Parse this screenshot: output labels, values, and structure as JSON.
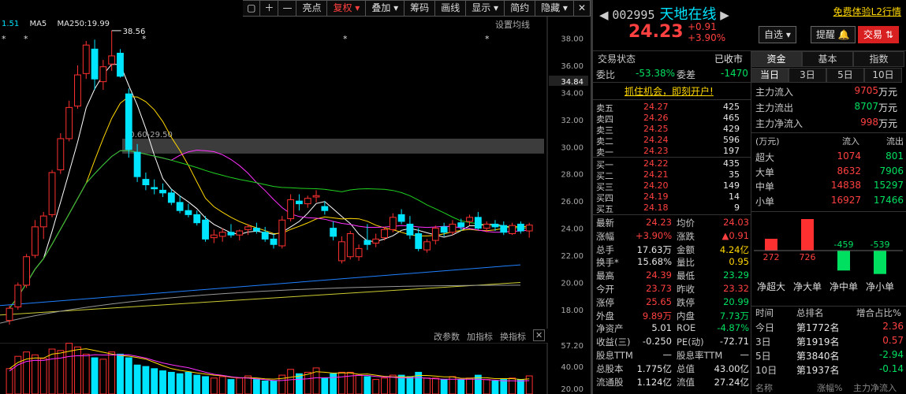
{
  "toolbar": {
    "buttons": [
      "亮点",
      "复权",
      "叠加",
      "筹码",
      "画线",
      "显示",
      "简约",
      "隐藏"
    ],
    "icons": [
      "window-icon",
      "plus-icon",
      "minus-icon"
    ]
  },
  "chart_top": {
    "ma_labels": [
      "1.51",
      "MA5",
      "MA250:19.99"
    ],
    "settings": "设置均线",
    "peak": "38.56",
    "band_label": "30.60-29.50",
    "markers": [
      "*",
      "*",
      "*",
      "*",
      "*",
      "*",
      "*"
    ]
  },
  "y_axis": {
    "ticks": [
      "38.00",
      "36.00",
      "34.00",
      "32.00",
      "30.00",
      "28.00",
      "26.00",
      "24.00",
      "22.00",
      "20.00",
      "18.00"
    ],
    "current": "34.84"
  },
  "indicator": {
    "buttons": [
      "改参数",
      "加指标",
      "换指标"
    ],
    "ticks": [
      "57.20",
      "40.00",
      "20.00"
    ]
  },
  "chart_data": {
    "type": "candlestick",
    "ylim": [
      16.6,
      39.6
    ],
    "candles": [
      {
        "o": 17.2,
        "h": 18.3,
        "l": 16.9,
        "c": 18.1
      },
      {
        "o": 18.2,
        "h": 20.0,
        "l": 18.0,
        "c": 19.8
      },
      {
        "o": 19.8,
        "h": 22.1,
        "l": 19.6,
        "c": 21.9
      },
      {
        "o": 22.0,
        "h": 24.6,
        "l": 21.8,
        "c": 24.1
      },
      {
        "o": 24.1,
        "h": 25.2,
        "l": 23.2,
        "c": 24.9
      },
      {
        "o": 25.0,
        "h": 28.3,
        "l": 24.8,
        "c": 28.1
      },
      {
        "o": 28.3,
        "h": 31.0,
        "l": 28.0,
        "c": 30.6
      },
      {
        "o": 30.6,
        "h": 33.4,
        "l": 30.4,
        "c": 32.9
      },
      {
        "o": 33.0,
        "h": 36.0,
        "l": 32.8,
        "c": 35.3
      },
      {
        "o": 35.4,
        "h": 37.8,
        "l": 35.0,
        "c": 37.5
      },
      {
        "o": 37.2,
        "h": 37.9,
        "l": 34.2,
        "c": 35.0
      },
      {
        "o": 34.8,
        "h": 36.4,
        "l": 34.2,
        "c": 35.9
      },
      {
        "o": 36.1,
        "h": 38.56,
        "l": 35.6,
        "c": 36.7
      },
      {
        "o": 36.9,
        "h": 37.2,
        "l": 35.1,
        "c": 35.2
      },
      {
        "o": 33.9,
        "h": 34.3,
        "l": 29.2,
        "c": 29.8
      },
      {
        "o": 29.6,
        "h": 30.2,
        "l": 27.4,
        "c": 27.8
      },
      {
        "o": 27.6,
        "h": 28.1,
        "l": 26.8,
        "c": 27.2
      },
      {
        "o": 27.0,
        "h": 27.6,
        "l": 26.5,
        "c": 26.9
      },
      {
        "o": 26.8,
        "h": 27.3,
        "l": 26.3,
        "c": 26.6
      },
      {
        "o": 26.6,
        "h": 26.9,
        "l": 25.7,
        "c": 25.9
      },
      {
        "o": 25.9,
        "h": 26.4,
        "l": 25.1,
        "c": 25.3
      },
      {
        "o": 25.3,
        "h": 25.8,
        "l": 24.8,
        "c": 25.0
      },
      {
        "o": 25.0,
        "h": 25.3,
        "l": 24.2,
        "c": 24.4
      },
      {
        "o": 24.6,
        "h": 24.9,
        "l": 23.0,
        "c": 23.2
      },
      {
        "o": 23.3,
        "h": 23.9,
        "l": 22.9,
        "c": 23.5
      },
      {
        "o": 23.4,
        "h": 24.0,
        "l": 23.0,
        "c": 23.7
      },
      {
        "o": 23.7,
        "h": 24.3,
        "l": 23.3,
        "c": 23.5
      },
      {
        "o": 23.5,
        "h": 23.9,
        "l": 23.1,
        "c": 23.8
      },
      {
        "o": 23.9,
        "h": 24.3,
        "l": 23.5,
        "c": 24.1
      },
      {
        "o": 24.0,
        "h": 24.4,
        "l": 23.6,
        "c": 23.8
      },
      {
        "o": 23.7,
        "h": 24.1,
        "l": 23.0,
        "c": 23.2
      },
      {
        "o": 23.2,
        "h": 23.6,
        "l": 22.5,
        "c": 22.8
      },
      {
        "o": 22.7,
        "h": 24.9,
        "l": 22.5,
        "c": 24.6
      },
      {
        "o": 24.7,
        "h": 26.5,
        "l": 24.5,
        "c": 26.1
      },
      {
        "o": 26.0,
        "h": 26.5,
        "l": 25.3,
        "c": 25.8
      },
      {
        "o": 25.8,
        "h": 26.4,
        "l": 25.5,
        "c": 26.2
      },
      {
        "o": 26.3,
        "h": 26.8,
        "l": 25.9,
        "c": 26.4
      },
      {
        "o": 25.6,
        "h": 26.0,
        "l": 25.0,
        "c": 25.3
      },
      {
        "o": 24.0,
        "h": 24.5,
        "l": 23.1,
        "c": 23.4
      },
      {
        "o": 21.6,
        "h": 23.4,
        "l": 21.4,
        "c": 23.0
      },
      {
        "o": 21.9,
        "h": 23.8,
        "l": 21.7,
        "c": 23.6
      },
      {
        "o": 21.9,
        "h": 22.8,
        "l": 21.6,
        "c": 22.5
      },
      {
        "o": 23.1,
        "h": 24.3,
        "l": 22.4,
        "c": 22.8
      },
      {
        "o": 22.9,
        "h": 23.6,
        "l": 22.6,
        "c": 23.2
      },
      {
        "o": 23.3,
        "h": 24.1,
        "l": 23.1,
        "c": 23.9
      },
      {
        "o": 23.9,
        "h": 25.1,
        "l": 23.7,
        "c": 24.8
      },
      {
        "o": 25.0,
        "h": 25.4,
        "l": 24.3,
        "c": 24.5
      },
      {
        "o": 24.3,
        "h": 24.9,
        "l": 23.2,
        "c": 23.5
      },
      {
        "o": 23.6,
        "h": 24.0,
        "l": 22.3,
        "c": 22.5
      },
      {
        "o": 22.4,
        "h": 23.2,
        "l": 22.2,
        "c": 23.0
      },
      {
        "o": 23.1,
        "h": 24.2,
        "l": 22.8,
        "c": 24.0
      },
      {
        "o": 24.1,
        "h": 24.4,
        "l": 23.4,
        "c": 23.7
      },
      {
        "o": 23.7,
        "h": 24.6,
        "l": 23.5,
        "c": 24.3
      },
      {
        "o": 24.4,
        "h": 24.7,
        "l": 23.8,
        "c": 24.1
      },
      {
        "o": 24.5,
        "h": 25.0,
        "l": 24.2,
        "c": 24.8
      },
      {
        "o": 24.8,
        "h": 25.2,
        "l": 23.9,
        "c": 24.0
      },
      {
        "o": 24.0,
        "h": 24.5,
        "l": 23.7,
        "c": 24.3
      },
      {
        "o": 24.3,
        "h": 24.6,
        "l": 23.8,
        "c": 24.1
      },
      {
        "o": 24.2,
        "h": 24.5,
        "l": 23.5,
        "c": 23.7
      },
      {
        "o": 23.6,
        "h": 24.4,
        "l": 23.5,
        "c": 24.2
      },
      {
        "o": 24.3,
        "h": 24.5,
        "l": 23.6,
        "c": 23.8
      },
      {
        "o": 23.8,
        "h": 24.4,
        "l": 23.3,
        "c": 24.23
      }
    ],
    "volumes": [
      35,
      52,
      58,
      54,
      49,
      62,
      60,
      70,
      65,
      55,
      50,
      48,
      58,
      55,
      50,
      40,
      38,
      35,
      32,
      30,
      28,
      30,
      26,
      24,
      22,
      24,
      20,
      22,
      25,
      20,
      18,
      18,
      26,
      34,
      28,
      30,
      36,
      22,
      28,
      30,
      30,
      26,
      24,
      20,
      22,
      26,
      26,
      24,
      30,
      22,
      22,
      20,
      24,
      20,
      22,
      26,
      20,
      18,
      20,
      22,
      20,
      25
    ]
  },
  "header": {
    "code": "002995",
    "name": "天地在线",
    "free_l2": "免费体验L2行情",
    "price": "24.23",
    "change": "+0.91",
    "pct": "+3.90%",
    "watchlist": "自选",
    "alert": "提醒",
    "trade": "交易"
  },
  "status": {
    "label": "交易状态",
    "value": "已收市"
  },
  "weibi": {
    "label1": "委比",
    "v1": "-53.38%",
    "label2": "委差",
    "v2": "-1470"
  },
  "promo": "抓住机会，即刻开户!",
  "asks": [
    {
      "l": "卖五",
      "p": "24.27",
      "v": "425"
    },
    {
      "l": "卖四",
      "p": "24.26",
      "v": "465"
    },
    {
      "l": "卖三",
      "p": "24.25",
      "v": "429"
    },
    {
      "l": "卖二",
      "p": "24.24",
      "v": "596"
    },
    {
      "l": "卖一",
      "p": "24.23",
      "v": "197"
    }
  ],
  "bids": [
    {
      "l": "买一",
      "p": "24.22",
      "v": "435"
    },
    {
      "l": "买二",
      "p": "24.21",
      "v": "35"
    },
    {
      "l": "买三",
      "p": "24.20",
      "v": "149"
    },
    {
      "l": "买四",
      "p": "24.19",
      "v": "14"
    },
    {
      "l": "买五",
      "p": "24.18",
      "v": "9"
    }
  ],
  "stats": [
    {
      "l1": "最新",
      "v1": "24.23",
      "l2": "均价",
      "v2": "24.03"
    },
    {
      "l1": "涨幅",
      "v1": "+3.90%",
      "l2": "涨跌",
      "v2": "▲0.91"
    },
    {
      "l1": "总手",
      "v1": "17.63万",
      "l2": "金额",
      "v2": "4.24亿"
    },
    {
      "l1": "换手*",
      "v1": "15.68%",
      "l2": "量比",
      "v2": "0.95"
    },
    {
      "l1": "最高",
      "v1": "24.39",
      "l2": "最低",
      "v2": "23.29"
    },
    {
      "l1": "今开",
      "v1": "23.73",
      "l2": "昨收",
      "v2": "23.32"
    },
    {
      "l1": "涨停",
      "v1": "25.65",
      "l2": "跌停",
      "v2": "20.99"
    },
    {
      "l1": "外盘",
      "v1": "9.89万",
      "l2": "内盘",
      "v2": "7.73万"
    },
    {
      "l1": "净资产",
      "v1": "5.01",
      "l2": "ROE",
      "v2": "-4.87%"
    },
    {
      "l1": "收益(三)",
      "v1": "-0.250",
      "l2": "PE(动)",
      "v2": "-72.71"
    },
    {
      "l1": "股息TTM",
      "v1": "—",
      "l2": "股息率TTM",
      "v2": "—"
    },
    {
      "l1": "总股本",
      "v1": "1.775亿",
      "l2": "总值",
      "v2": "43.00亿"
    },
    {
      "l1": "流通股",
      "v1": "1.124亿",
      "l2": "流值",
      "v2": "27.24亿"
    }
  ],
  "fund": {
    "tabs": [
      "资金",
      "基本",
      "指数"
    ],
    "periods": [
      "当日",
      "3日",
      "5日",
      "10日"
    ],
    "flows": [
      {
        "l": "主力流入",
        "v": "9705",
        "u": "万元"
      },
      {
        "l": "主力流出",
        "v": "8707",
        "u": "万元"
      },
      {
        "l": "主力净流入",
        "v": "998",
        "u": "万元"
      }
    ],
    "head": [
      "(万元)",
      "流入",
      "流出"
    ],
    "orders": [
      {
        "l": "超大",
        "i": "1074",
        "o": "801"
      },
      {
        "l": "大单",
        "i": "8632",
        "o": "7906"
      },
      {
        "l": "中单",
        "i": "14838",
        "o": "15297"
      },
      {
        "l": "小单",
        "i": "16927",
        "o": "17466"
      }
    ],
    "net": [
      {
        "l": "净超大",
        "v": 272
      },
      {
        "l": "净大单",
        "v": 726
      },
      {
        "l": "净中单",
        "v": -459
      },
      {
        "l": "净小单",
        "v": -539
      }
    ],
    "rank_head": [
      "时间",
      "总排名",
      "增合占比%"
    ],
    "ranks": [
      {
        "t": "今日",
        "r": "第1772名",
        "p": "2.36"
      },
      {
        "t": "3日",
        "r": "第1919名",
        "p": "0.57"
      },
      {
        "t": "5日",
        "r": "第3840名",
        "p": "-2.94"
      },
      {
        "t": "10日",
        "r": "第1937名",
        "p": "-0.14"
      }
    ],
    "bottom": [
      "名称",
      "涨幅%",
      "主力净流入"
    ]
  }
}
